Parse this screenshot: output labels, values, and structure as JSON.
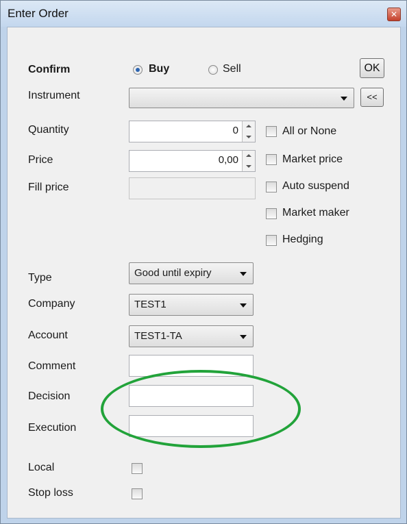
{
  "window": {
    "title": "Enter Order"
  },
  "confirm_label": "Confirm",
  "side": {
    "buy_label": "Buy",
    "sell_label": "Sell",
    "selected": "Buy"
  },
  "ok_label": "OK",
  "instrument": {
    "label": "Instrument",
    "value": "",
    "expand_label": "<<"
  },
  "quantity": {
    "label": "Quantity",
    "value": "0"
  },
  "price": {
    "label": "Price",
    "value": "0,00"
  },
  "fill_price": {
    "label": "Fill price",
    "value": ""
  },
  "options": [
    {
      "label": "All or None",
      "checked": false
    },
    {
      "label": "Market price",
      "checked": false
    },
    {
      "label": "Auto suspend",
      "checked": false
    },
    {
      "label": "Market maker",
      "checked": false
    },
    {
      "label": "Hedging",
      "checked": false
    }
  ],
  "type": {
    "label": "Type",
    "value": "Good until expiry"
  },
  "company": {
    "label": "Company",
    "value": "TEST1"
  },
  "account": {
    "label": "Account",
    "value": "TEST1-TA"
  },
  "comment": {
    "label": "Comment",
    "value": ""
  },
  "decision": {
    "label": "Decision",
    "value": ""
  },
  "execution": {
    "label": "Execution",
    "value": ""
  },
  "local": {
    "label": "Local",
    "checked": false
  },
  "stop_loss": {
    "label": "Stop loss",
    "checked": false
  },
  "highlight_color": "#22a33a"
}
